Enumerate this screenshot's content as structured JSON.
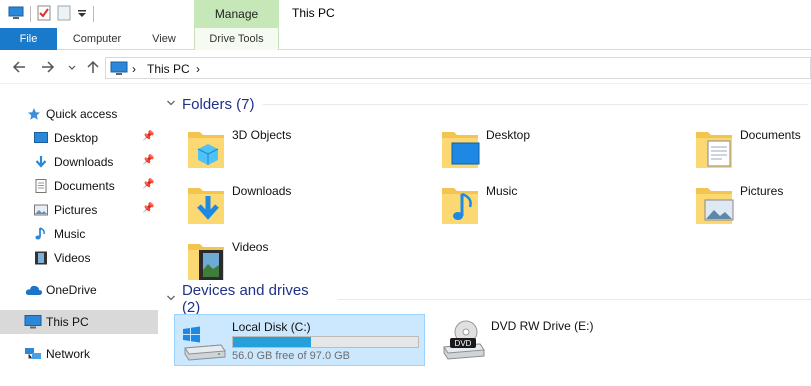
{
  "window": {
    "title": "This PC",
    "context_tab_label": "Manage"
  },
  "quick_access_toolbar": {
    "items": [
      "computer-icon",
      "properties-check-icon",
      "new-folder-icon",
      "customize-dropdown-icon"
    ]
  },
  "ribbon": {
    "tabs": [
      {
        "label": "File",
        "active": true
      },
      {
        "label": "Computer"
      },
      {
        "label": "View"
      },
      {
        "label": "Drive Tools"
      }
    ]
  },
  "address": {
    "crumbs": [
      "This PC"
    ]
  },
  "nav_pane": {
    "items": [
      {
        "label": "Quick access",
        "icon": "star-icon"
      },
      {
        "label": "Desktop",
        "icon": "desktop-icon",
        "pinned": true
      },
      {
        "label": "Downloads",
        "icon": "download-arrow-icon",
        "pinned": true
      },
      {
        "label": "Documents",
        "icon": "document-icon",
        "pinned": true
      },
      {
        "label": "Pictures",
        "icon": "picture-icon",
        "pinned": true
      },
      {
        "label": "Music",
        "icon": "music-note-icon"
      },
      {
        "label": "Videos",
        "icon": "film-icon"
      },
      {
        "label": "OneDrive",
        "icon": "cloud-icon"
      },
      {
        "label": "This PC",
        "icon": "computer-icon",
        "selected": true
      },
      {
        "label": "Network",
        "icon": "network-icon"
      }
    ]
  },
  "folders": {
    "header": "Folders (7)",
    "items": [
      {
        "label": "3D Objects",
        "icon": "3d-objects-folder-icon"
      },
      {
        "label": "Desktop",
        "icon": "desktop-folder-icon"
      },
      {
        "label": "Documents",
        "icon": "documents-folder-icon"
      },
      {
        "label": "Downloads",
        "icon": "downloads-folder-icon"
      },
      {
        "label": "Music",
        "icon": "music-folder-icon"
      },
      {
        "label": "Pictures",
        "icon": "pictures-folder-icon"
      },
      {
        "label": "Videos",
        "icon": "videos-folder-icon"
      }
    ]
  },
  "devices": {
    "header": "Devices and drives (2)",
    "items": [
      {
        "label": "Local Disk (C:)",
        "free_text": "56.0 GB free of 97.0 GB",
        "used_fraction": 0.42,
        "icon": "windows-drive-icon",
        "selected": true
      },
      {
        "label": "DVD RW Drive (E:)",
        "icon": "dvd-drive-icon",
        "badge": "DVD"
      }
    ]
  },
  "colors": {
    "accent": "#1979ca",
    "context_tab": "#c6e8b8",
    "selection": "#cce8ff",
    "section_header": "#1e3287",
    "progress": "#26a0da"
  }
}
